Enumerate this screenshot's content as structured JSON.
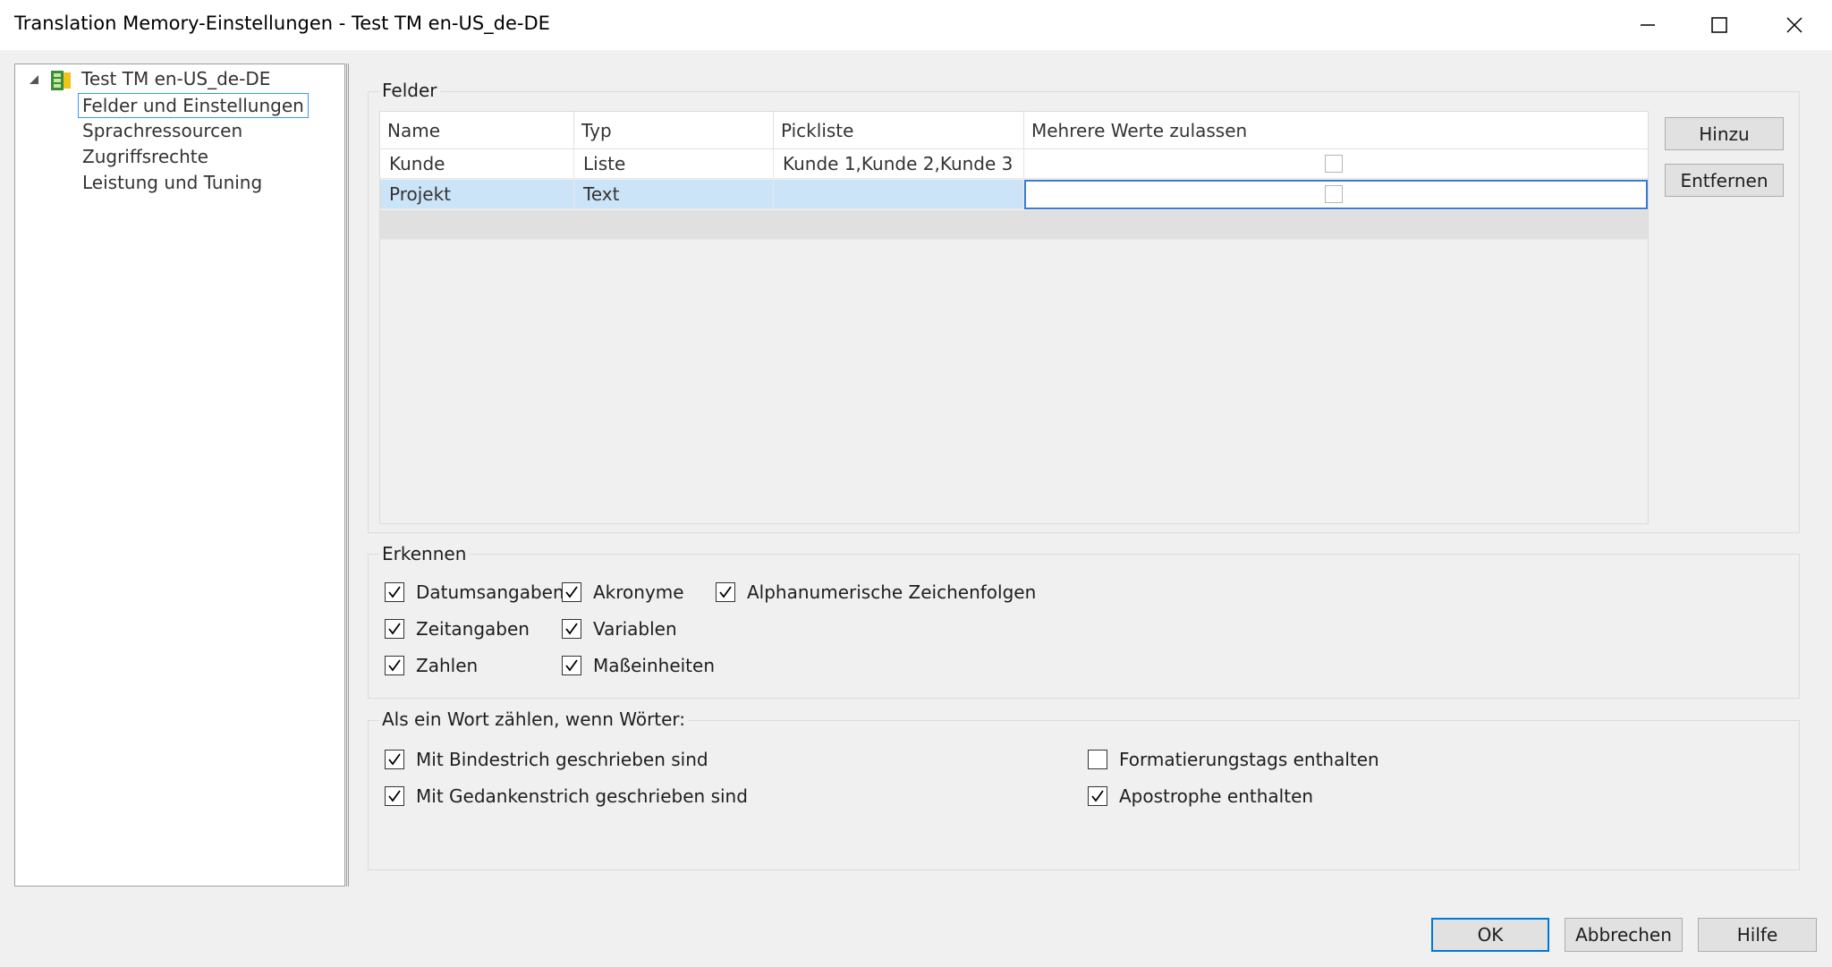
{
  "window": {
    "title": "Translation Memory-Einstellungen - Test TM en-US_de-DE"
  },
  "tree": {
    "root": "Test TM en-US_de-DE",
    "items": [
      {
        "label": "Felder und Einstellungen",
        "selected": true
      },
      {
        "label": "Sprachressourcen"
      },
      {
        "label": "Zugriffsrechte"
      },
      {
        "label": "Leistung und Tuning"
      }
    ]
  },
  "fields_group": {
    "label": "Felder",
    "columns": [
      "Name",
      "Typ",
      "Pickliste",
      "Mehrere Werte zulassen"
    ],
    "rows": [
      {
        "name": "Kunde",
        "type": "Liste",
        "picklist": "Kunde 1,Kunde 2,Kunde 3",
        "multi": false
      },
      {
        "name": "Projekt",
        "type": "Text",
        "picklist": "",
        "multi": false
      }
    ],
    "add_button": "Hinzu",
    "remove_button": "Entfernen"
  },
  "recognize_group": {
    "label": "Erkennen",
    "options": [
      {
        "label": "Datumsangaben",
        "checked": true
      },
      {
        "label": "Zeitangaben",
        "checked": true
      },
      {
        "label": "Zahlen",
        "checked": true
      },
      {
        "label": "Akronyme",
        "checked": true
      },
      {
        "label": "Variablen",
        "checked": true
      },
      {
        "label": "Maßeinheiten",
        "checked": true
      },
      {
        "label": "Alphanumerische Zeichenfolgen",
        "checked": true
      }
    ]
  },
  "word_group": {
    "label": "Als ein Wort zählen, wenn Wörter:",
    "options": [
      {
        "label": "Mit Bindestrich geschrieben sind",
        "checked": true
      },
      {
        "label": "Mit Gedankenstrich geschrieben sind",
        "checked": true
      },
      {
        "label": "Formatierungstags enthalten",
        "checked": false
      },
      {
        "label": "Apostrophe enthalten",
        "checked": true
      }
    ]
  },
  "footer": {
    "ok": "OK",
    "cancel": "Abbrechen",
    "help": "Hilfe"
  }
}
